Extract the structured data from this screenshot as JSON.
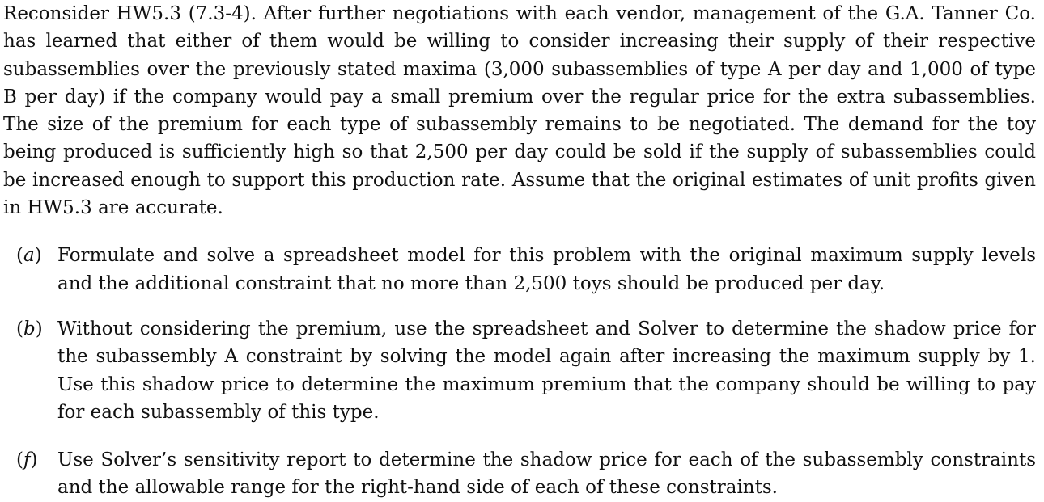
{
  "intro": "Reconsider HW5.3 (7.3-4). After further negotiations with each vendor, management of the G.A. Tanner Co. has learned that either of them would be willing to consider increasing their supply of their respective subassemblies over the previously stated maxima (3,000 subassemblies of type A per day and 1,000 of type B per day) if the company would pay a small premium over the regular price for the extra subassemblies. The size of the premium for each type of subassembly remains to be negotiated. The demand for the toy being produced is sufficiently high so that 2,500 per day could be sold if the supply of subassemblies could be increased enough to support this production rate. Assume that the original estimates of unit profits given in HW5.3 are accurate.",
  "items": [
    {
      "letter": "a",
      "text": "Formulate and solve a spreadsheet model for this problem with the original maximum supply levels and the additional constraint that no more than 2,500 toys should be produced per day."
    },
    {
      "letter": "b",
      "text": "Without considering the premium, use the spreadsheet and Solver to determine the shadow price for the subassembly A constraint by solving the model again after increasing the maximum supply by 1. Use this shadow price to determine the maximum premium that the company should be willing to pay for each subassembly of this type."
    },
    {
      "letter": "f",
      "text": "Use Solver’s sensitivity report to determine the shadow price for each of the subassembly constraints and the allowable range for the right-hand side of each of these constraints."
    }
  ]
}
